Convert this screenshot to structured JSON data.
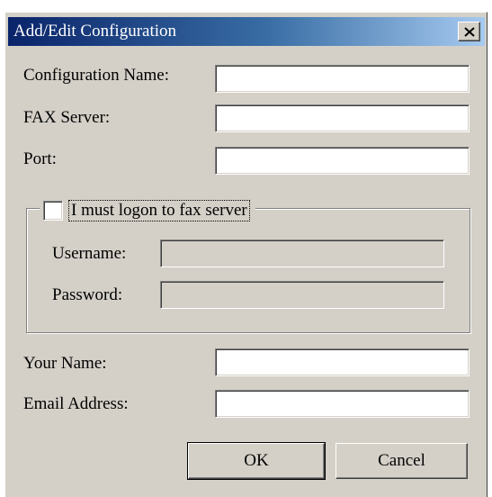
{
  "window": {
    "title": "Add/Edit Configuration",
    "close_glyph": "✕"
  },
  "fields": {
    "configuration_name": {
      "label": "Configuration Name:",
      "value": ""
    },
    "fax_server": {
      "label": "FAX Server:",
      "value": ""
    },
    "port": {
      "label": "Port:",
      "value": ""
    },
    "your_name": {
      "label": "Your Name:",
      "value": ""
    },
    "email_address": {
      "label": "Email Address:",
      "value": ""
    }
  },
  "logon_group": {
    "checkbox_label": "I must logon to fax server",
    "checked": false,
    "username": {
      "label": "Username:",
      "value": "",
      "enabled": false
    },
    "password": {
      "label": "Password:",
      "value": "",
      "enabled": false
    }
  },
  "buttons": {
    "ok": "OK",
    "cancel": "Cancel"
  },
  "colors": {
    "dialog_face": "#d4d0c8",
    "title_gradient_start": "#0a246a",
    "title_gradient_end": "#a6caf0"
  }
}
